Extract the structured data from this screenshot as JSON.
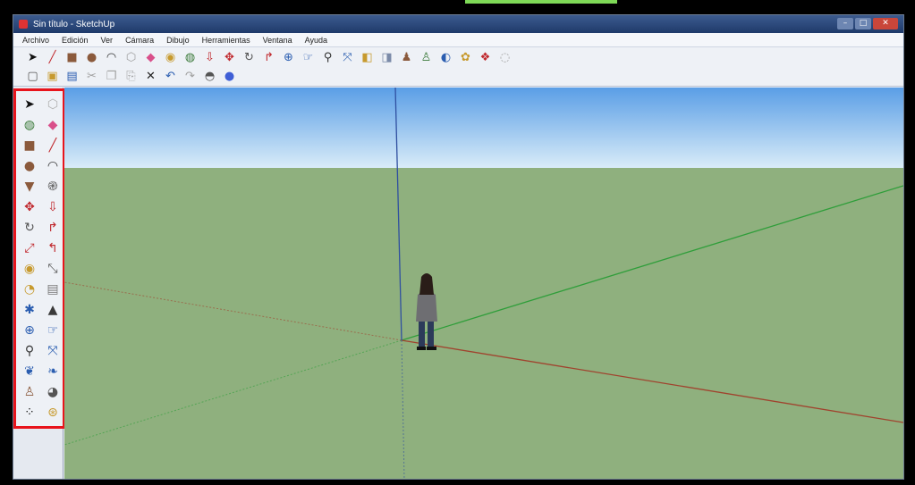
{
  "window": {
    "title": "Sin título - SketchUp",
    "controls": {
      "minimize": "–",
      "maximize": "□",
      "close": "✕"
    }
  },
  "menu": [
    "Archivo",
    "Edición",
    "Ver",
    "Cámara",
    "Dibujo",
    "Herramientas",
    "Ventana",
    "Ayuda"
  ],
  "toolbar_1": [
    {
      "icon": "select-arrow-icon",
      "glyph": "➤",
      "color": "#111111"
    },
    {
      "icon": "line-pencil-icon",
      "glyph": "╱",
      "color": "#c0282d"
    },
    {
      "icon": "rectangle-icon",
      "glyph": "■",
      "color": "#8b5a3c"
    },
    {
      "icon": "circle-icon",
      "glyph": "●",
      "color": "#8b5a3c"
    },
    {
      "icon": "arc-icon",
      "glyph": "◠",
      "color": "#333333"
    },
    {
      "icon": "polygon-icon",
      "glyph": "⬡",
      "color": "#a0a0a0"
    },
    {
      "icon": "eraser-icon",
      "glyph": "◆",
      "color": "#d94f8a"
    },
    {
      "icon": "tape-measure-icon",
      "glyph": "◉",
      "color": "#c79a2e"
    },
    {
      "icon": "paint-bucket-icon",
      "glyph": "◍",
      "color": "#3b7a3a"
    },
    {
      "icon": "push-pull-icon",
      "glyph": "⇩",
      "color": "#c0282d"
    },
    {
      "icon": "move-icon",
      "glyph": "✥",
      "color": "#c0282d"
    },
    {
      "icon": "rotate-icon",
      "glyph": "↻",
      "color": "#555555"
    },
    {
      "icon": "follow-me-icon",
      "glyph": "↱",
      "color": "#c0282d"
    },
    {
      "icon": "orbit-icon",
      "glyph": "⊕",
      "color": "#2a5db0"
    },
    {
      "icon": "pan-icon",
      "glyph": "☞",
      "color": "#2a5db0"
    },
    {
      "icon": "zoom-icon",
      "glyph": "⚲",
      "color": "#333333"
    },
    {
      "icon": "zoom-extents-icon",
      "glyph": "⤧",
      "color": "#2a5db0"
    },
    {
      "icon": "previous-view-icon",
      "glyph": "◧",
      "color": "#c79a2e"
    },
    {
      "icon": "next-view-icon",
      "glyph": "◨",
      "color": "#7a8aa8"
    },
    {
      "icon": "position-camera-icon",
      "glyph": "♟",
      "color": "#8b5a3c"
    },
    {
      "icon": "walk-icon",
      "glyph": "♙",
      "color": "#3b7a3a"
    },
    {
      "icon": "get-models-icon",
      "glyph": "◐",
      "color": "#2a5db0"
    },
    {
      "icon": "share-model-icon",
      "glyph": "✿",
      "color": "#c79a2e"
    },
    {
      "icon": "components-icon",
      "glyph": "❖",
      "color": "#c0282d"
    },
    {
      "icon": "extension-icon",
      "glyph": "◌",
      "color": "#a0a0a0"
    }
  ],
  "toolbar_2": [
    {
      "icon": "new-file-icon",
      "glyph": "▢",
      "color": "#555555"
    },
    {
      "icon": "open-folder-icon",
      "glyph": "▣",
      "color": "#c79a2e"
    },
    {
      "icon": "save-icon",
      "glyph": "▤",
      "color": "#2a5db0"
    },
    {
      "icon": "cut-icon",
      "glyph": "✂",
      "color": "#a0a0a0"
    },
    {
      "icon": "copy-icon",
      "glyph": "❐",
      "color": "#a0a0a0"
    },
    {
      "icon": "paste-icon",
      "glyph": "⎘",
      "color": "#a0a0a0"
    },
    {
      "icon": "delete-icon",
      "glyph": "✕",
      "color": "#222222"
    },
    {
      "icon": "undo-icon",
      "glyph": "↶",
      "color": "#2a5db0"
    },
    {
      "icon": "redo-icon",
      "glyph": "↷",
      "color": "#a0a0a0"
    },
    {
      "icon": "print-icon",
      "glyph": "◓",
      "color": "#555555"
    },
    {
      "icon": "model-info-icon",
      "glyph": "●",
      "color": "#3f5fd6"
    }
  ],
  "left_toolbar": [
    {
      "icon": "select-arrow-icon",
      "glyph": "➤",
      "color": "#111111"
    },
    {
      "icon": "make-component-icon",
      "glyph": "⬡",
      "color": "#b0b0b0"
    },
    {
      "icon": "paint-bucket-icon",
      "glyph": "◍",
      "color": "#3b7a3a"
    },
    {
      "icon": "eraser-icon",
      "glyph": "◆",
      "color": "#d94f8a"
    },
    {
      "icon": "rectangle-icon",
      "glyph": "■",
      "color": "#8b5a3c"
    },
    {
      "icon": "line-pencil-icon",
      "glyph": "╱",
      "color": "#c0282d"
    },
    {
      "icon": "circle-icon",
      "glyph": "●",
      "color": "#8b5a3c"
    },
    {
      "icon": "arc-icon",
      "glyph": "◠",
      "color": "#333333"
    },
    {
      "icon": "polygon-icon",
      "glyph": "▼",
      "color": "#8b5a3c"
    },
    {
      "icon": "freehand-icon",
      "glyph": "֎",
      "color": "#555555"
    },
    {
      "icon": "move-icon",
      "glyph": "✥",
      "color": "#c0282d"
    },
    {
      "icon": "push-pull-icon",
      "glyph": "⇩",
      "color": "#c0282d"
    },
    {
      "icon": "rotate-icon",
      "glyph": "↻",
      "color": "#555555"
    },
    {
      "icon": "follow-me-icon",
      "glyph": "↱",
      "color": "#c0282d"
    },
    {
      "icon": "scale-icon",
      "glyph": "⤢",
      "color": "#c0282d"
    },
    {
      "icon": "offset-icon",
      "glyph": "↰",
      "color": "#c0282d"
    },
    {
      "icon": "tape-measure-icon",
      "glyph": "◉",
      "color": "#c79a2e"
    },
    {
      "icon": "dimension-icon",
      "glyph": "⤡",
      "color": "#555555"
    },
    {
      "icon": "protractor-icon",
      "glyph": "◔",
      "color": "#c79a2e"
    },
    {
      "icon": "text-icon",
      "glyph": "▤",
      "color": "#7a7a7a"
    },
    {
      "icon": "axes-icon",
      "glyph": "✱",
      "color": "#2a5db0"
    },
    {
      "icon": "3d-text-icon",
      "glyph": "▲",
      "color": "#3a3a3a"
    },
    {
      "icon": "orbit-icon",
      "glyph": "⊕",
      "color": "#2a5db0"
    },
    {
      "icon": "pan-icon",
      "glyph": "☞",
      "color": "#2a5db0"
    },
    {
      "icon": "zoom-icon",
      "glyph": "⚲",
      "color": "#333333"
    },
    {
      "icon": "zoom-extents-icon",
      "glyph": "⤧",
      "color": "#2a5db0"
    },
    {
      "icon": "previous-view-icon",
      "glyph": "❦",
      "color": "#2a5db0"
    },
    {
      "icon": "next-view-icon",
      "glyph": "❧",
      "color": "#2a5db0"
    },
    {
      "icon": "position-camera-icon",
      "glyph": "♙",
      "color": "#8b5a3c"
    },
    {
      "icon": "look-around-icon",
      "glyph": "◕",
      "color": "#555555"
    },
    {
      "icon": "walk-icon",
      "glyph": "⁘",
      "color": "#222222"
    },
    {
      "icon": "section-plane-icon",
      "glyph": "⊛",
      "color": "#c79a2e"
    }
  ],
  "colors": {
    "sky_top": "#5a9ee6",
    "sky_bottom": "#d9ecf8",
    "ground": "#8fb07e",
    "axis_red": "#a0432e",
    "axis_green": "#2f9e3a",
    "axis_blue": "#2f4fa0",
    "highlight": "#e8141c",
    "accent": "#7ed957"
  }
}
